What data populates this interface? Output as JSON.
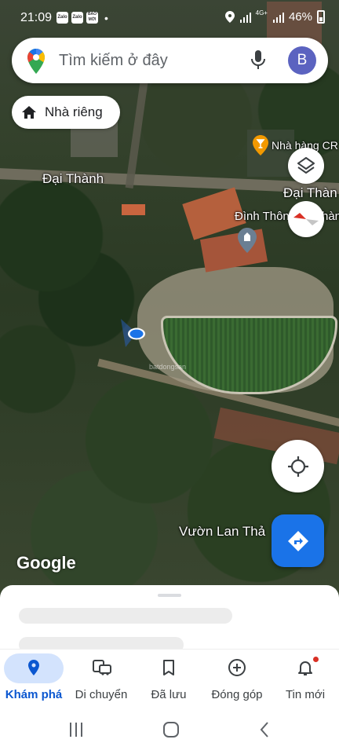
{
  "status_bar": {
    "time": "21:09",
    "app_icons": [
      "Zalo",
      "Zalo",
      "BÁO MỚI"
    ],
    "network": "4G+",
    "battery": "46%"
  },
  "search": {
    "placeholder": "Tìm kiếm ở đây",
    "avatar_letter": "B"
  },
  "chip": {
    "label": "Nhà riêng"
  },
  "map": {
    "labels": {
      "dai_thanh_left": "Đại Thành",
      "dai_thanh_right": "Đại Thàn",
      "restaurant": "Nhà hàng CR",
      "temple": "Đình Thôn",
      "temple_suffix": "hàn",
      "garden": "Vườn Lan Thả"
    },
    "watermark": "batdongsan",
    "google_logo": "Google"
  },
  "bottom_nav": {
    "items": [
      {
        "label": "Khám phá",
        "icon": "location-pin-icon",
        "active": true
      },
      {
        "label": "Di chuyển",
        "icon": "commute-icon"
      },
      {
        "label": "Đã lưu",
        "icon": "bookmark-icon"
      },
      {
        "label": "Đóng góp",
        "icon": "add-circle-icon"
      },
      {
        "label": "Tin mới",
        "icon": "bell-icon",
        "badge": true
      }
    ]
  },
  "colors": {
    "accent": "#1a73e8",
    "active_pill": "#d3e3fd",
    "avatar": "#5b63c0",
    "notification_dot": "#d93025"
  }
}
